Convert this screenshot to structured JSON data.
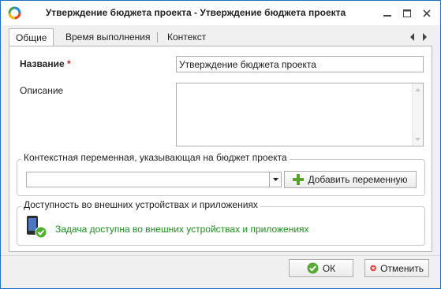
{
  "window": {
    "title": "Утверждение бюджета проекта - Утверждение бюджета проекта",
    "accent_color": "#1e6fb8"
  },
  "titlebar_icons": {
    "logo": "app-logo-icon",
    "minimize": "minimize-icon",
    "maximize": "maximize-icon",
    "close": "close-icon"
  },
  "tabs": [
    {
      "label": "Общие",
      "active": true
    },
    {
      "label": "Время выполнения",
      "active": false
    },
    {
      "label": "Контекст",
      "active": false
    }
  ],
  "form": {
    "name_label": "Название",
    "required_mark": "*",
    "name_value": "Утверждение бюджета проекта",
    "description_label": "Описание",
    "description_value": ""
  },
  "context_group": {
    "title": "Контекстная переменная, указывающая на бюджет проекта",
    "selected_value": "",
    "add_button_label": "Добавить переменную"
  },
  "availability_group": {
    "title": "Доступность во внешних устройствах и приложениях",
    "status_text": "Задача доступна во внешних устройствах и приложениях",
    "status_color": "#1f8a1f"
  },
  "footer": {
    "ok_label": "ОК",
    "cancel_label": "Отменить"
  }
}
